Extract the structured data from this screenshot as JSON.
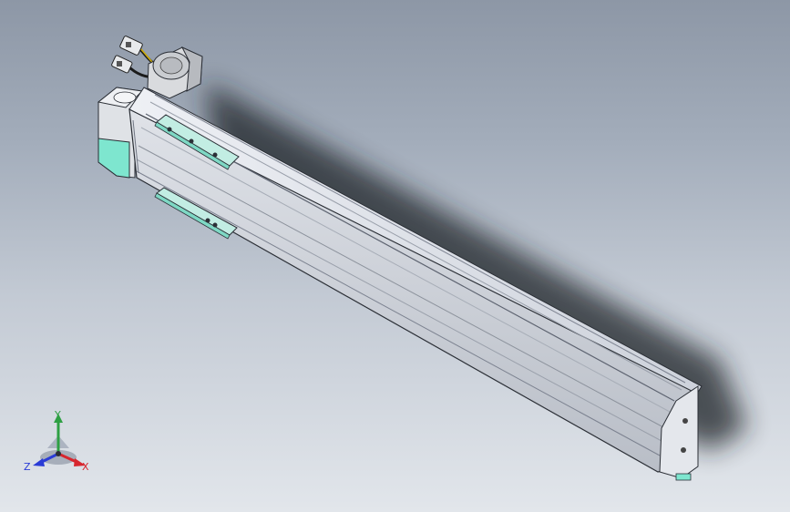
{
  "viewport": {
    "background_top": "#8d97a6",
    "background_bottom": "#e2e6eb",
    "model": {
      "body_color": "#c7cbd3",
      "edge_color": "#2b2f36",
      "carriage_color": "#9fe0d2",
      "motor_color": "#d4d6d9",
      "shadow_color": "#1e2126"
    }
  },
  "triad": {
    "y_label": "Y",
    "x_label": "X",
    "z_label": "Z",
    "y_color": "#2ea043",
    "x_color": "#d7262e",
    "z_color": "#2a3cd6"
  }
}
